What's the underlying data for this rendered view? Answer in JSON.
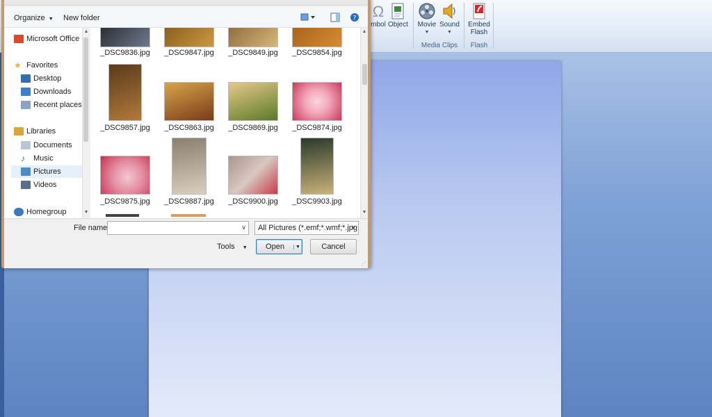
{
  "ribbon": {
    "buttons": [
      {
        "key": "symbol",
        "label": "mbol",
        "icon": "omega-icon"
      },
      {
        "key": "object",
        "label": "Object",
        "icon": "object-icon"
      },
      {
        "key": "movie",
        "label": "Movie",
        "icon": "film-reel-icon"
      },
      {
        "key": "sound",
        "label": "Sound",
        "icon": "speaker-icon"
      },
      {
        "key": "flash",
        "label": "Embed\nFlash",
        "icon": "flash-icon"
      }
    ],
    "groups": {
      "media_clips": "Media Clips",
      "flash": "Flash"
    }
  },
  "dialog": {
    "toolbar": {
      "organize": "Organize",
      "new_folder": "New folder",
      "organize_arrow": "▼"
    },
    "nav": {
      "items": [
        {
          "label": "Microsoft Office Pi",
          "color": "#d84a2a",
          "indent": 0
        },
        {
          "label": "Favorites",
          "color": "#e8b43a",
          "indent": 0
        },
        {
          "label": "Desktop",
          "color": "#2f6fb7",
          "indent": 1
        },
        {
          "label": "Downloads",
          "color": "#3a7fc8",
          "indent": 1
        },
        {
          "label": "Recent places",
          "color": "#8aa4c4",
          "indent": 1
        },
        {
          "label": "Libraries",
          "color": "#d9a43a",
          "indent": 0
        },
        {
          "label": "Documents",
          "color": "#b9c6d6",
          "indent": 1
        },
        {
          "label": "Music",
          "color": "#2c6ab0",
          "indent": 1
        },
        {
          "label": "Pictures",
          "color": "#4a8cc8",
          "indent": 1
        },
        {
          "label": "Videos",
          "color": "#5a6f8a",
          "indent": 1
        },
        {
          "label": "Homegroup",
          "color": "#3f78c0",
          "indent": 0
        }
      ]
    },
    "files": [
      {
        "name": "_DSC9836.jpg",
        "colors": [
          "#2a2a30",
          "#6c7a8e"
        ]
      },
      {
        "name": "_DSC9847.jpg",
        "colors": [
          "#8a5a1a",
          "#c99a42"
        ]
      },
      {
        "name": "_DSC9849.jpg",
        "colors": [
          "#8a6a3a",
          "#d8b67a"
        ]
      },
      {
        "name": "_DSC9854.jpg",
        "colors": [
          "#a8621a",
          "#d68a32"
        ]
      },
      {
        "name": "_DSC9857.jpg",
        "colors": [
          "#5a3a1a",
          "#b27a3a"
        ]
      },
      {
        "name": "_DSC9863.jpg",
        "colors": [
          "#d8a44a",
          "#7a3a1a"
        ]
      },
      {
        "name": "_DSC9869.jpg",
        "colors": [
          "#e6c88a",
          "#5a7a2a"
        ]
      },
      {
        "name": "_DSC9874.jpg",
        "colors": [
          "#f2a6b8",
          "#c83a5a"
        ]
      },
      {
        "name": "_DSC9875.jpg",
        "colors": [
          "#c8324a",
          "#f5c6d2"
        ]
      },
      {
        "name": "_DSC9887.jpg",
        "colors": [
          "#8a8070",
          "#d8cfc0"
        ]
      },
      {
        "name": "_DSC9900.jpg",
        "colors": [
          "#a89890",
          "#c83a4a"
        ]
      },
      {
        "name": "_DSC9903.jpg",
        "colors": [
          "#2a3a2a",
          "#c8b27a"
        ]
      }
    ],
    "bottom": {
      "file_name_label": "File name:",
      "file_name_value": "",
      "file_type": "All Pictures (*.emf;*.wmf;*.jpg;*",
      "tools": "Tools",
      "tools_arrow": "▼",
      "open": "Open",
      "open_split": "▼",
      "cancel": "Cancel"
    }
  }
}
